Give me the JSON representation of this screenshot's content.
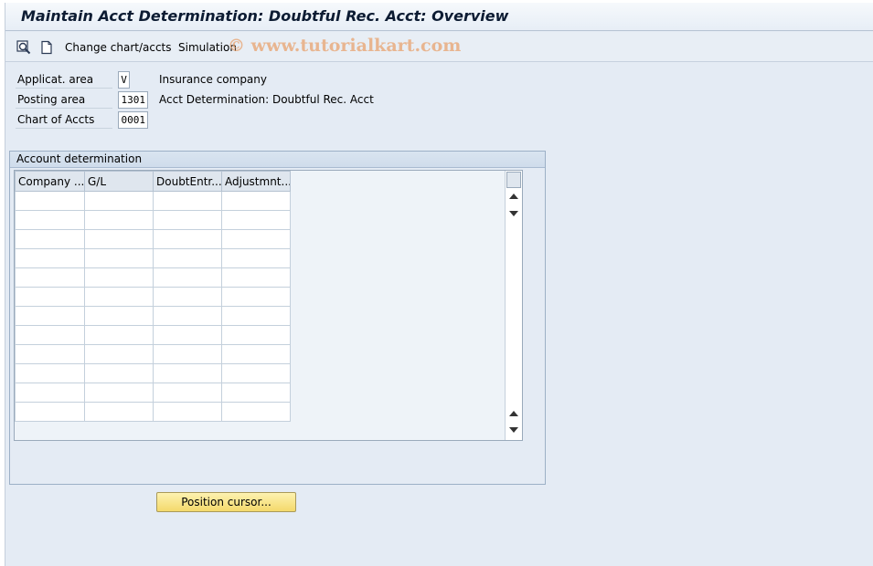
{
  "window": {
    "title": "Maintain Acct Determination: Doubtful Rec. Acct: Overview"
  },
  "toolbar": {
    "icons": [
      "find-icon",
      "new-document-icon"
    ],
    "change_chart_label": "Change chart/accts",
    "simulation_label": "Simulation",
    "watermark": "© www.tutorialkart.com"
  },
  "header_fields": {
    "application_area": {
      "label": "Applicat. area",
      "value": "V",
      "description": "Insurance company"
    },
    "posting_area": {
      "label": "Posting area",
      "value": "1301",
      "description": "Acct Determination: Doubtful Rec. Acct"
    },
    "chart_of_accounts": {
      "label": "Chart of Accts",
      "value": "0001"
    }
  },
  "account_determination": {
    "title": "Account determination",
    "columns": [
      "Company ...",
      "G/L",
      "DoubtEntr...",
      "Adjustmnt..."
    ],
    "rows": [
      [
        "",
        "",
        "",
        ""
      ],
      [
        "",
        "",
        "",
        ""
      ],
      [
        "",
        "",
        "",
        ""
      ],
      [
        "",
        "",
        "",
        ""
      ],
      [
        "",
        "",
        "",
        ""
      ],
      [
        "",
        "",
        "",
        ""
      ],
      [
        "",
        "",
        "",
        ""
      ],
      [
        "",
        "",
        "",
        ""
      ],
      [
        "",
        "",
        "",
        ""
      ],
      [
        "",
        "",
        "",
        ""
      ],
      [
        "",
        "",
        "",
        ""
      ],
      [
        "",
        "",
        "",
        ""
      ]
    ]
  },
  "buttons": {
    "position_cursor": "Position cursor..."
  },
  "colors": {
    "background": "#e4ebf4",
    "button_yellow": "#f4d96b",
    "title_text": "#0d1c33"
  }
}
